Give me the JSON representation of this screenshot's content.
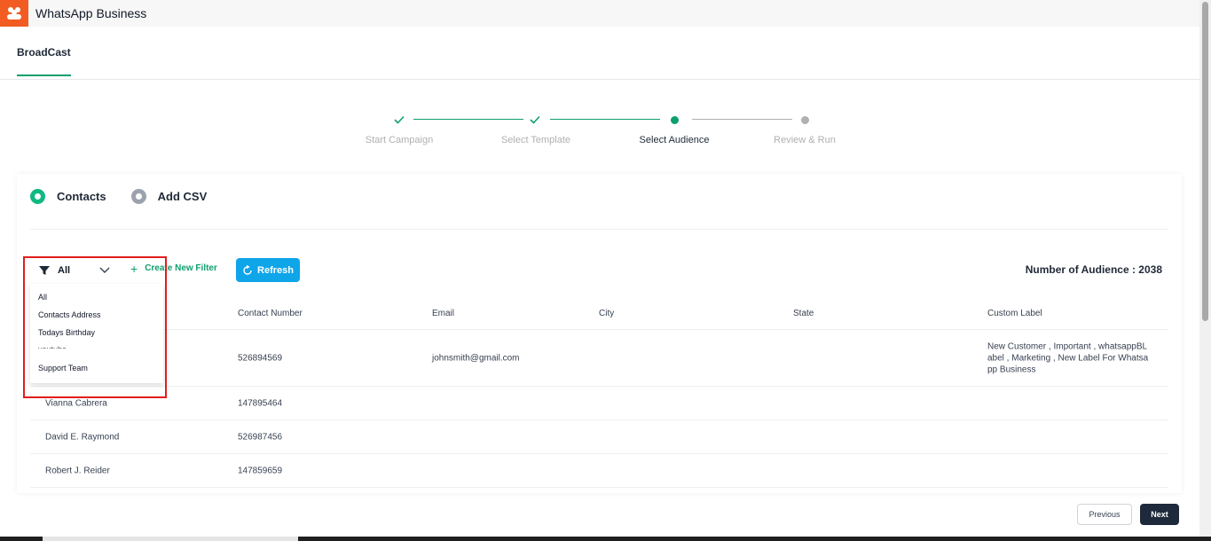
{
  "app": {
    "title": "WhatsApp Business",
    "logo_icon": "people-group-icon",
    "brand_color": "#f25c22"
  },
  "tabs": [
    {
      "label": "BroadCast",
      "active": true
    }
  ],
  "stepper": {
    "steps": [
      {
        "label": "Start Campaign",
        "state": "done"
      },
      {
        "label": "Select Template",
        "state": "done"
      },
      {
        "label": "Select Audience",
        "state": "current"
      },
      {
        "label": "Review & Run",
        "state": "pending"
      }
    ],
    "done_color": "#0e9f6e",
    "pending_color": "#b0b0b0"
  },
  "source": {
    "options": [
      {
        "label": "Contacts",
        "selected": true
      },
      {
        "label": "Add CSV",
        "selected": false
      }
    ]
  },
  "toolbar": {
    "filter_value": "All",
    "create_filter_label": "Create New Filter",
    "refresh_label": "Refresh",
    "audience_label": "Number of Audience : 2038"
  },
  "filter_dropdown": {
    "items": [
      "All",
      "Contacts Address",
      "Todays Birthday",
      "youtube",
      "Support Team"
    ]
  },
  "table": {
    "columns": [
      "Contact Number",
      "Email",
      "City",
      "State",
      "Custom Label"
    ],
    "rows": [
      {
        "name": "",
        "number": "526894569",
        "email": "johnsmith@gmail.com",
        "city": "",
        "state": "",
        "label_lines": [
          "New Customer , Important , whatsappBL",
          "abel , Marketing , New Label For Whatsa",
          "pp Business"
        ]
      },
      {
        "name": "Vianna Cabrera",
        "number": "147895464",
        "email": "",
        "city": "",
        "state": "",
        "label_lines": []
      },
      {
        "name": "David E. Raymond",
        "number": "526987456",
        "email": "",
        "city": "",
        "state": "",
        "label_lines": []
      },
      {
        "name": "Robert J. Reider",
        "number": "147859659",
        "email": "",
        "city": "",
        "state": "",
        "label_lines": []
      }
    ]
  },
  "footer": {
    "previous_label": "Previous",
    "next_label": "Next"
  },
  "colors": {
    "accent": "#0e9f6e",
    "refresh": "#0ea5e9",
    "next_btn": "#1e2a3b",
    "highlight": "#e11d1d"
  }
}
